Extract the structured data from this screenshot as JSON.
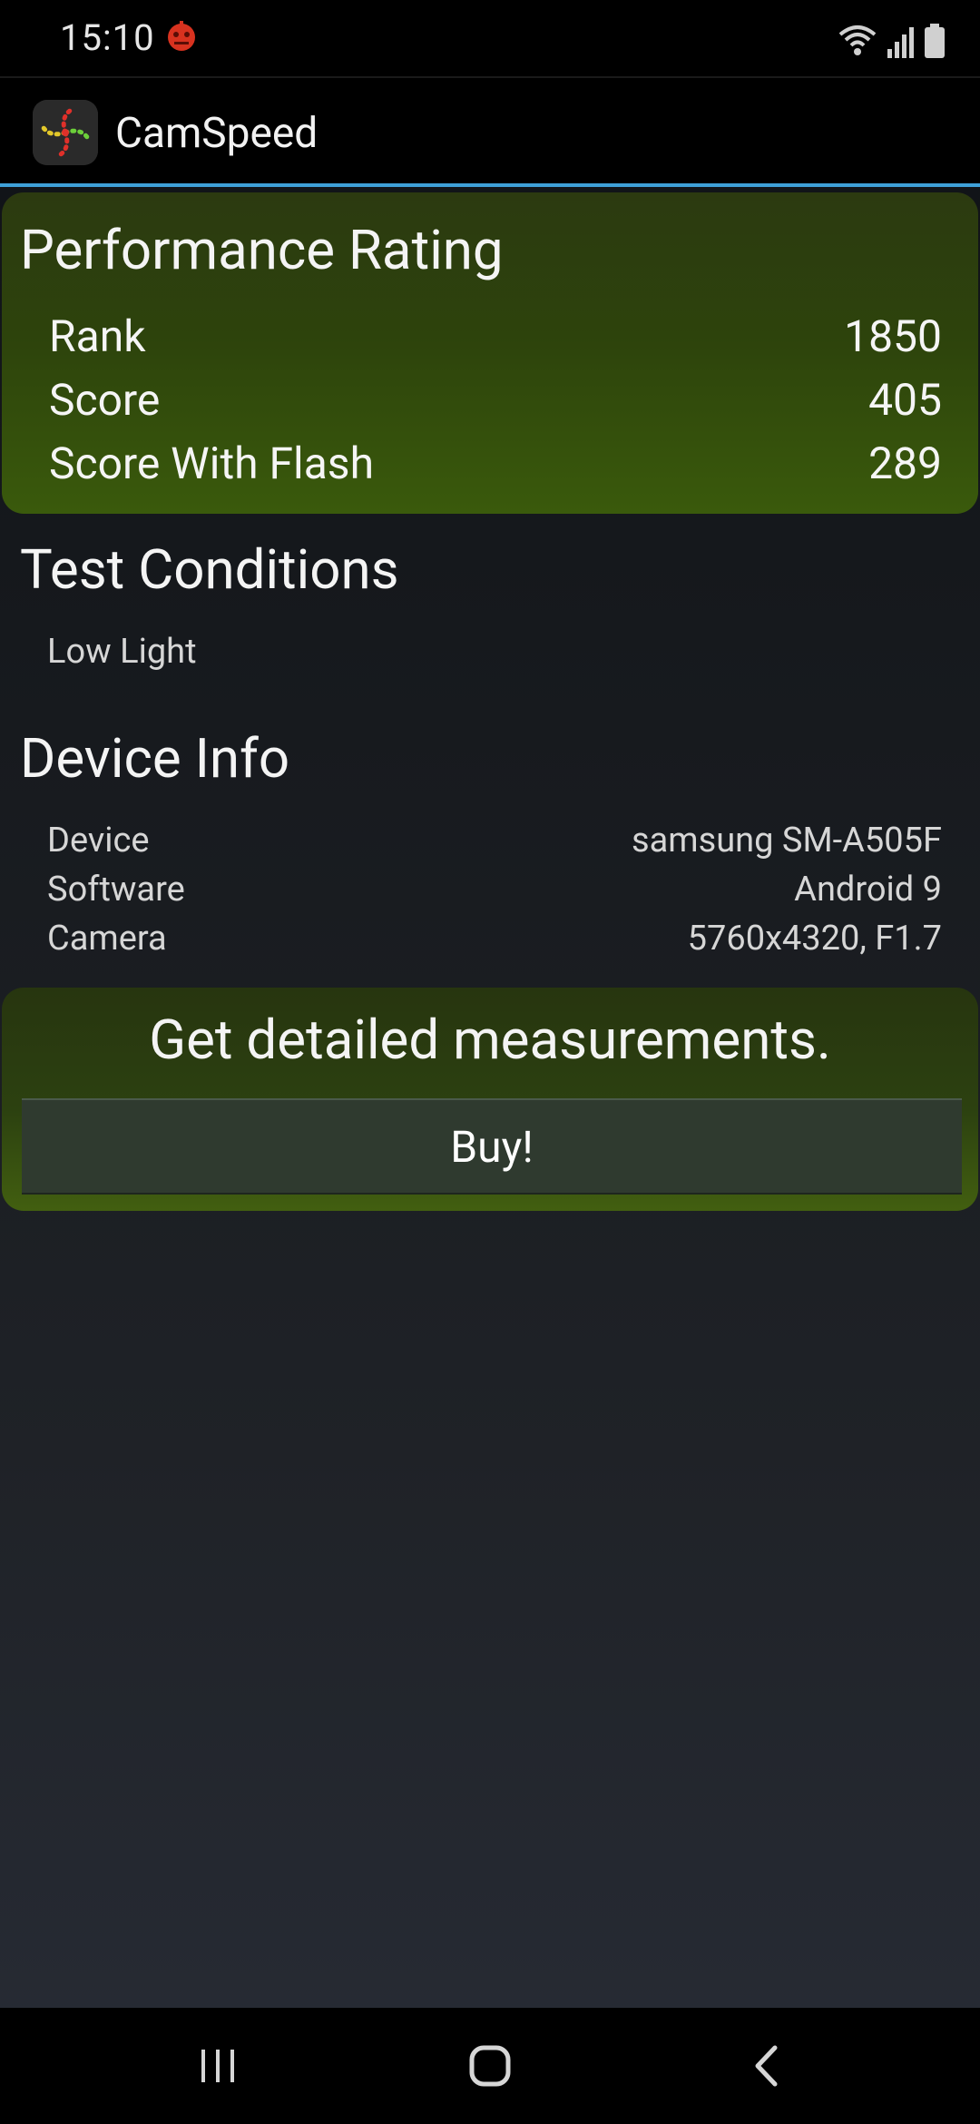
{
  "status_bar": {
    "time": "15:10",
    "icons": [
      "notification-app-icon",
      "wifi-icon",
      "signal-icon",
      "battery-icon"
    ]
  },
  "app_bar": {
    "title": "CamSpeed",
    "icon": "camspeed-app-icon",
    "accent_color": "#3ea0d8"
  },
  "performance": {
    "title": "Performance Rating",
    "rows": [
      {
        "label": "Rank",
        "value": "1850"
      },
      {
        "label": "Score",
        "value": "405"
      },
      {
        "label": "Score With Flash",
        "value": "289"
      }
    ]
  },
  "test_conditions": {
    "title": "Test Conditions",
    "value": "Low Light"
  },
  "device_info": {
    "title": "Device Info",
    "rows": [
      {
        "label": "Device",
        "value": "samsung SM-A505F"
      },
      {
        "label": "Software",
        "value": "Android 9"
      },
      {
        "label": "Camera",
        "value": "5760x4320, F1.7"
      }
    ]
  },
  "upsell": {
    "text": "Get detailed measurements.",
    "button_label": "Buy!"
  },
  "nav_bar": {
    "buttons": [
      "recent-apps-icon",
      "home-icon",
      "back-icon"
    ]
  },
  "colors": {
    "card_green": "#2d430c",
    "button_bg": "#2f3a2f"
  }
}
